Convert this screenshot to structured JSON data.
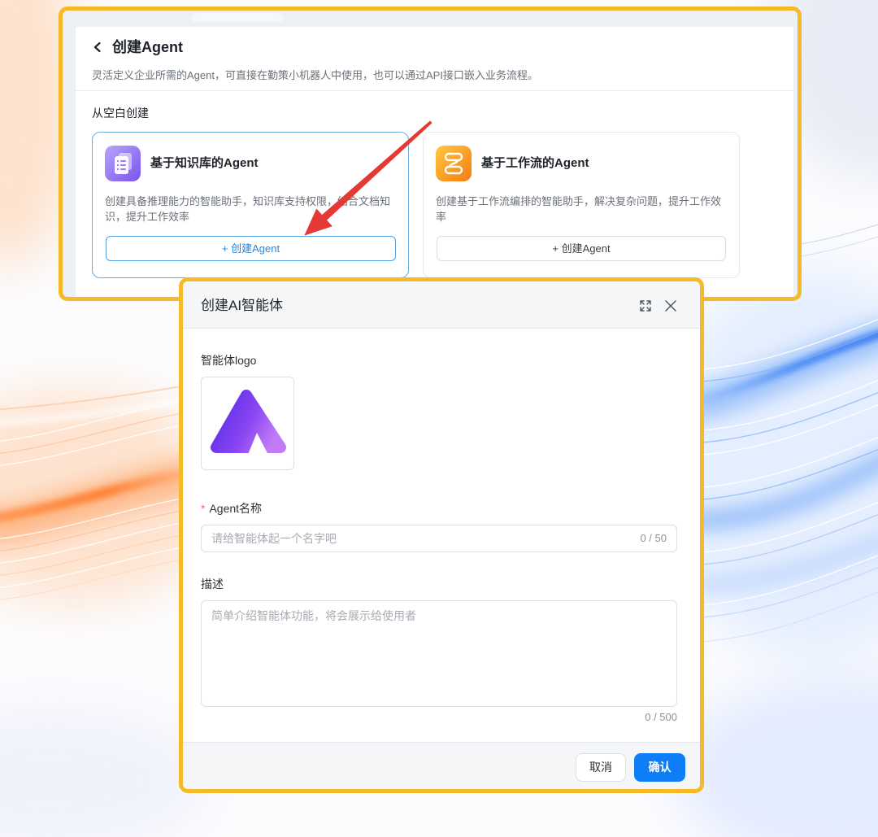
{
  "colors": {
    "highlight_frame": "#f7b928",
    "annotation_arrow": "#e53935",
    "primary": "#0d7ef6",
    "selected_card_border": "#6aaee0",
    "required_mark": "#f56c6c"
  },
  "page": {
    "back_icon": "chevron-left-icon",
    "title": "创建Agent",
    "subtitle": "灵活定义企业所需的Agent，可直接在勤策小机器人中使用，也可以通过API接口嵌入业务流程。",
    "section_title": "从空白创建",
    "cards": [
      {
        "icon": "knowledge-base-icon",
        "title": "基于知识库的Agent",
        "description": "创建具备推理能力的智能助手，知识库支持权限，结合文档知识，提升工作效率",
        "button_label": "+ 创建Agent",
        "selected": true
      },
      {
        "icon": "workflow-icon",
        "title": "基于工作流的Agent",
        "description": "创建基于工作流编排的智能助手，解决复杂问题，提升工作效率",
        "button_label": "+ 创建Agent",
        "selected": false
      }
    ]
  },
  "dialog": {
    "title": "创建AI智能体",
    "expand_icon": "expand-icon",
    "close_icon": "close-icon",
    "logo_label": "智能体logo",
    "logo_icon": "agent-logo-icon",
    "name": {
      "required_mark": "*",
      "label": "Agent名称",
      "value": "",
      "placeholder": "请给智能体起一个名字吧",
      "counter": "0 / 50"
    },
    "description": {
      "label": "描述",
      "value": "",
      "placeholder": "简单介绍智能体功能，将会展示给使用者",
      "counter": "0 / 500"
    },
    "cancel_label": "取消",
    "confirm_label": "确认"
  }
}
